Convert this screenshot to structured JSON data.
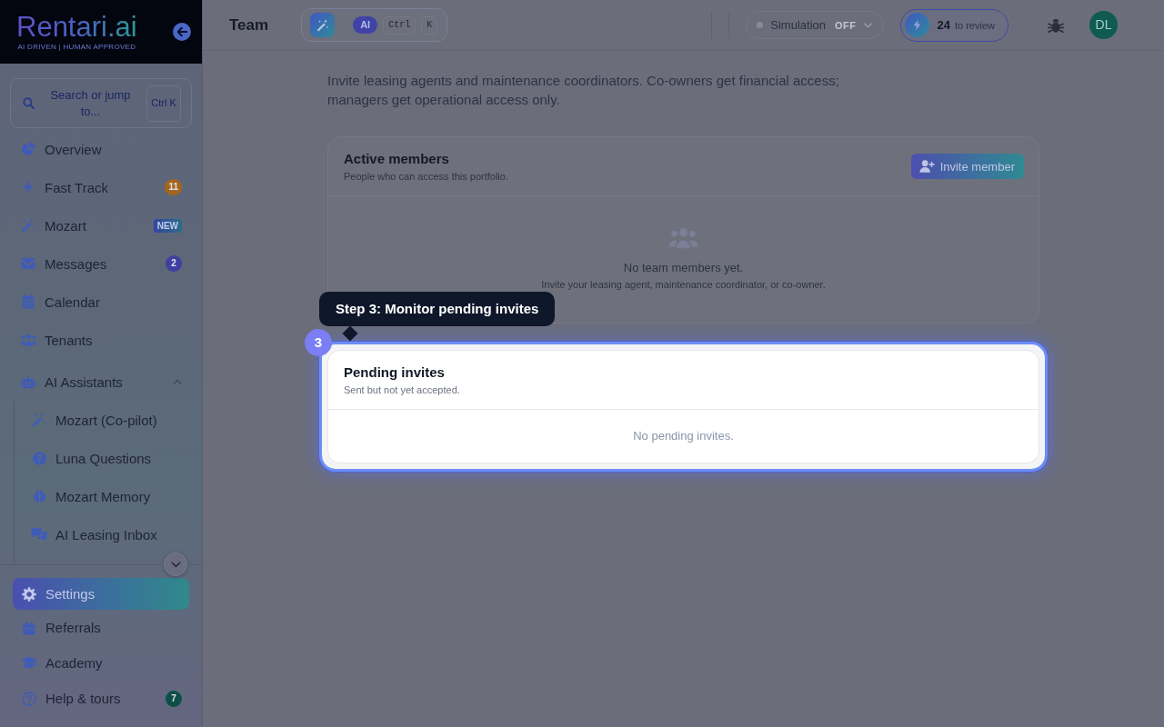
{
  "sidebar": {
    "logo": {
      "wordmark": "Rentari.ai",
      "tagline": "AI DRIVEN | HUMAN APPROVED"
    },
    "search": {
      "label": "Search or jump to...",
      "shortcut": "Ctrl K"
    },
    "nav": [
      {
        "label": "Overview",
        "selected": false
      },
      {
        "label": "Fast Track",
        "selected": false,
        "badge": {
          "kind": "count",
          "text": "11",
          "color": "#a4661f"
        }
      },
      {
        "label": "Mozart",
        "selected": false,
        "badge": {
          "kind": "tag",
          "text": "NEW"
        }
      },
      {
        "label": "Messages",
        "selected": false,
        "badge": {
          "kind": "count",
          "text": "2",
          "color": "#3e40a0"
        }
      },
      {
        "label": "Calendar",
        "selected": false
      },
      {
        "label": "Tenants",
        "selected": false
      },
      {
        "label": "AI Assistants",
        "selected": false,
        "expanded": true,
        "children": [
          {
            "label": "Mozart (Co-pilot)",
            "selected": false
          },
          {
            "label": "Luna Questions",
            "selected": false
          },
          {
            "label": "Mozart Memory",
            "selected": false
          },
          {
            "label": "AI Leasing Inbox",
            "selected": false
          }
        ]
      }
    ],
    "footer_nav": [
      {
        "label": "Settings",
        "selected": true
      },
      {
        "label": "Referrals",
        "selected": false
      },
      {
        "label": "Academy",
        "selected": false
      },
      {
        "label": "Help & tours",
        "selected": false,
        "badge": {
          "kind": "count",
          "text": "7",
          "color": "#0c4f46"
        }
      }
    ]
  },
  "header": {
    "title": "Team",
    "ai_command": {
      "label": "AI",
      "keys": [
        "Ctrl",
        "K"
      ]
    },
    "simulation": {
      "label": "Simulation",
      "value": "OFF",
      "on": false
    },
    "review": {
      "count": "24",
      "label": "to review"
    },
    "avatar": {
      "initials": "DL"
    }
  },
  "main": {
    "description": "Invite leasing agents and maintenance coordinators. Co-owners get financial access; managers get operational access only.",
    "cards": [
      {
        "title": "Active members",
        "subtitle": "People who can access this portfolio.",
        "action": "Invite member",
        "highlighted": false,
        "empty": {
          "title": "No team members yet.",
          "text": "Invite your leasing agent, maintenance coordinator, or co-owner."
        }
      },
      {
        "title": "Pending invites",
        "subtitle": "Sent but not yet accepted.",
        "highlighted": true,
        "empty": {
          "text": "No pending invites."
        },
        "tour": {
          "step": "3",
          "title": "Step 3: Monitor pending invites"
        }
      }
    ]
  }
}
